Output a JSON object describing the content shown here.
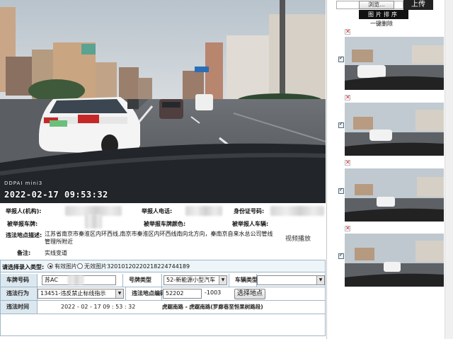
{
  "photo": {
    "brand": "DDPAI  mini3",
    "timestamp": "2022-02-17  09:53:32"
  },
  "info": {
    "reporter_org_label": "举报人(机构):",
    "reporter_phone_label": "举报人电话:",
    "id_card_label": "身份证号码:",
    "reported_plate_label": "被举报车牌:",
    "reported_plate_color_label": "被举报车牌颜色:",
    "reported_vehicle_type_label": "被举报人车辆:",
    "address_label": "违法地点描述:",
    "address_value": "江苏省南京市秦淮区内环西线,南京市秦淮区内环西线南向北方向，秦南京自来水总公司管线管理所附近",
    "remark_label": "备注:",
    "remark_value": "实线变道",
    "video_link": "视频播放"
  },
  "form": {
    "record_type_label": "请选择录入类型:",
    "valid_photo_label": "有效图片",
    "invalid_photo_label": "无效图片",
    "record_id": "320101202202182247441​89",
    "plate_label": "车牌号码",
    "plate_value": "苏AC",
    "plate_type_label": "号牌类型",
    "plate_type_value": "52-新能源小型汽车",
    "vehicle_type_label": "车辆类型",
    "vehicle_type_value": "",
    "violation_label": "违法行为",
    "violation_value": "13451-违反禁止标线指示",
    "location_code_label": "违法地点编码",
    "location_code_a": "52202",
    "location_code_b": "-1003",
    "select_location_button": "选择地点",
    "time_label": "违法时间",
    "time_value": "2022 - 02 - 17   09 : 53 : 32",
    "location_name": "虎踞南路 - 虎踞南路(罗廊巷至恒果树路段)"
  },
  "upload": {
    "browse_button": "浏览...",
    "upload_button": "上传",
    "sort_button": "图片排序",
    "delete_all": "一键删除",
    "delete_icon": "✕",
    "thumbnails": [
      {
        "checked": true
      },
      {
        "checked": true
      },
      {
        "checked": true
      },
      {
        "checked": true
      }
    ]
  },
  "colors": {
    "accent_blue": "#9fb8c8",
    "header_bg": "#dce8ef",
    "delete_red": "#d0101a"
  }
}
